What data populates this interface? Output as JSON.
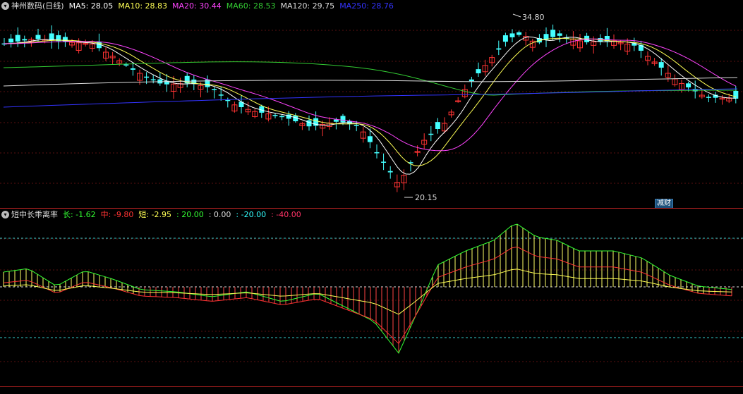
{
  "main": {
    "stock_name": "神州数码(日线)",
    "ma": [
      {
        "label": "MA5: 28.05",
        "color": "#ffffff"
      },
      {
        "label": "MA10: 28.83",
        "color": "#ffff55"
      },
      {
        "label": "MA20: 30.44",
        "color": "#ff44ff"
      },
      {
        "label": "MA60: 28.53",
        "color": "#33cc33"
      },
      {
        "label": "MA120: 29.75",
        "color": "#dddddd"
      },
      {
        "label": "MA250: 28.76",
        "color": "#3333ff"
      }
    ],
    "high_label": "34.80",
    "low_label": "20.15",
    "badge": "减财"
  },
  "sub": {
    "indicator_name": "短中长乖离率",
    "values": [
      {
        "label": "长: -1.62",
        "color": "#33ff33"
      },
      {
        "label": "中: -9.80",
        "color": "#ff3333"
      },
      {
        "label": "短: -2.95",
        "color": "#ffff55"
      },
      {
        "label": ": 20.00",
        "color": "#33ff33"
      },
      {
        "label": ": 0.00",
        "color": "#dddddd"
      },
      {
        "label": ": -20.00",
        "color": "#33ffff"
      },
      {
        "label": ": -40.00",
        "color": "#ff3366"
      }
    ]
  },
  "colors": {
    "up": "#ff3333",
    "down": "#44ffff",
    "grid": "#8b1a1a"
  },
  "icons": {
    "legend_toggle": "chevron-down-icon"
  }
}
